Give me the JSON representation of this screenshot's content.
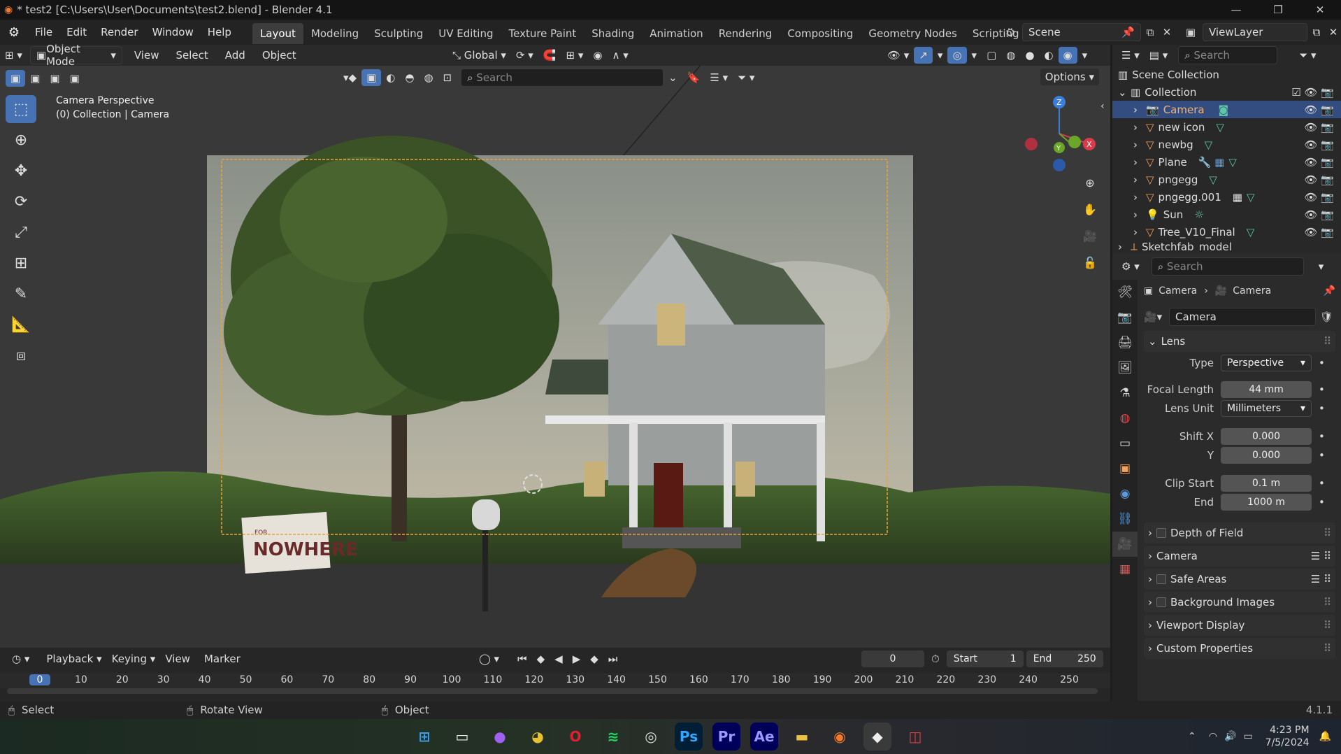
{
  "window": {
    "title": "* test2 [C:\\Users\\User\\Documents\\test2.blend] - Blender 4.1"
  },
  "menu": [
    "File",
    "Edit",
    "Render",
    "Window",
    "Help"
  ],
  "workspaces": [
    "Layout",
    "Modeling",
    "Sculpting",
    "UV Editing",
    "Texture Paint",
    "Shading",
    "Animation",
    "Rendering",
    "Compositing",
    "Geometry Nodes",
    "Scripting"
  ],
  "scene": {
    "name": "Scene",
    "view_layer": "ViewLayer"
  },
  "viewport_header": {
    "mode": "Object Mode",
    "menus": [
      "View",
      "Select",
      "Add",
      "Object"
    ],
    "transform": "Global",
    "options": "Options"
  },
  "search": {
    "placeholder": "Search"
  },
  "viewport": {
    "title": "Camera Perspective",
    "subtitle": "(0) Collection | Camera",
    "sign_small": "FOR",
    "sign_text": "NOWHERE"
  },
  "outliner": {
    "root": "Scene Collection",
    "collection": "Collection",
    "items": [
      "Camera",
      "new icon",
      "newbg",
      "Plane",
      "pngegg",
      "pngegg.001",
      "Sun",
      "Tree_V10_Final",
      "Sketchfab_model"
    ]
  },
  "properties": {
    "breadcrumb": [
      "Camera",
      "Camera"
    ],
    "data_name": "Camera",
    "lens": {
      "header": "Lens",
      "type_label": "Type",
      "type": "Perspective",
      "focal_label": "Focal Length",
      "focal": "44 mm",
      "unit_label": "Lens Unit",
      "unit": "Millimeters",
      "shiftx_label": "Shift X",
      "shiftx": "0.000",
      "y_label": "Y",
      "shifty": "0.000",
      "clipstart_label": "Clip Start",
      "clipstart": "0.1 m",
      "end_label": "End",
      "clipend": "1000 m"
    },
    "panels": [
      "Depth of Field",
      "Camera",
      "Safe Areas",
      "Background Images",
      "Viewport Display",
      "Custom Properties"
    ]
  },
  "timeline": {
    "menus": [
      "Playback",
      "Keying",
      "View",
      "Marker"
    ],
    "current": "0",
    "start_label": "Start",
    "start": "1",
    "end_label": "End",
    "end": "250",
    "ticks": [
      "0",
      "10",
      "20",
      "30",
      "40",
      "50",
      "60",
      "70",
      "80",
      "90",
      "100",
      "110",
      "120",
      "130",
      "140",
      "150",
      "160",
      "170",
      "180",
      "190",
      "200",
      "210",
      "220",
      "230",
      "240",
      "250"
    ]
  },
  "status": {
    "select": "Select",
    "rotate": "Rotate View",
    "object": "Object",
    "version": "4.1.1"
  },
  "taskbar": {
    "time": "4:23 PM",
    "date": "7/5/2024"
  }
}
